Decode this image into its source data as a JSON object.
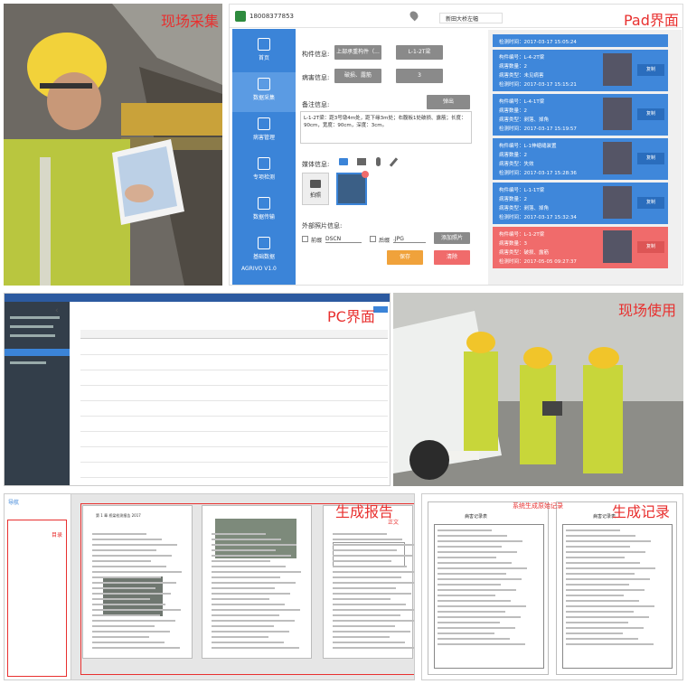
{
  "captions": {
    "field_collect": "现场采集",
    "pad_ui": "Pad界面",
    "pc_ui": "PC界面",
    "field_use": "现场使用",
    "gen_report": "生成报告",
    "gen_record": "生成记录"
  },
  "pad": {
    "phone": "18008377853",
    "location": "新田大桥左幅",
    "sidebar": [
      "首页",
      "数据采集",
      "病害管理",
      "专项检测",
      "数据传输",
      "基础数据"
    ],
    "version": "AGRIVO V1.0",
    "component_label": "构件信息:",
    "component_values": [
      "上部承重构件（...",
      "L-1-2T梁"
    ],
    "disease_label": "病害信息:",
    "disease_values": [
      "破损、露筋",
      "3"
    ],
    "remark_label": "备注信息:",
    "remark_button": "弹出",
    "remark_text": "L-1-2T梁：距3号墩4m处，距下缘3m处；右腹板1处破损、露筋；长度：90cm，宽度：90cm，深度：3cm。",
    "media_label": "媒体信息:",
    "photo_label": "拍照",
    "external_label": "外部照片信息:",
    "prefix_label": "前缀",
    "prefix_value": "DSCN",
    "suffix_label": "后缀",
    "suffix_value": ".JPG",
    "add_photo": "添加照片",
    "save": "保存",
    "clear": "清除",
    "cards": [
      {
        "lines": [
          "检测时间：2017-03-17 15:05:24"
        ],
        "copy": ""
      },
      {
        "lines": [
          "构件编号：L-4-2T梁",
          "病害数量：2",
          "病害类型：未见病害",
          "检测时间：2017-03-17 15:15:21"
        ],
        "copy": "复制"
      },
      {
        "lines": [
          "构件编号：L-4-1T梁",
          "病害数量：2",
          "病害类型：剥落、掉角",
          "检测时间：2017-03-17 15:19:57"
        ],
        "copy": "复制"
      },
      {
        "lines": [
          "构件编号：L-1伸缩缝装置",
          "病害数量：2",
          "病害类型：失效",
          "检测时间：2017-03-17 15:28:36"
        ],
        "copy": "复制"
      },
      {
        "lines": [
          "构件编号：L-1-1T梁",
          "病害数量：2",
          "病害类型：剥落、掉角",
          "检测时间：2017-03-17 15:32:34"
        ],
        "copy": "复制"
      },
      {
        "lines": [
          "构件编号：L-1-2T梁",
          "病害数量：3",
          "病害类型：破损、露筋",
          "检测时间：2017-05-05 09:27:37"
        ],
        "copy": "复制"
      }
    ],
    "badge": "×1"
  },
  "report": {
    "outline_title": "导航",
    "toc_label": "目录",
    "body_label": "正文",
    "page_title": "第 1 章 桥梁检测报告 2017"
  },
  "record": {
    "title": "病害记录表",
    "system_label": "系统生成原始记录"
  },
  "colors": {
    "accent": "#3b84d8",
    "caption": "#e8302f",
    "danger": "#f06b6b",
    "save": "#f0a23b"
  }
}
